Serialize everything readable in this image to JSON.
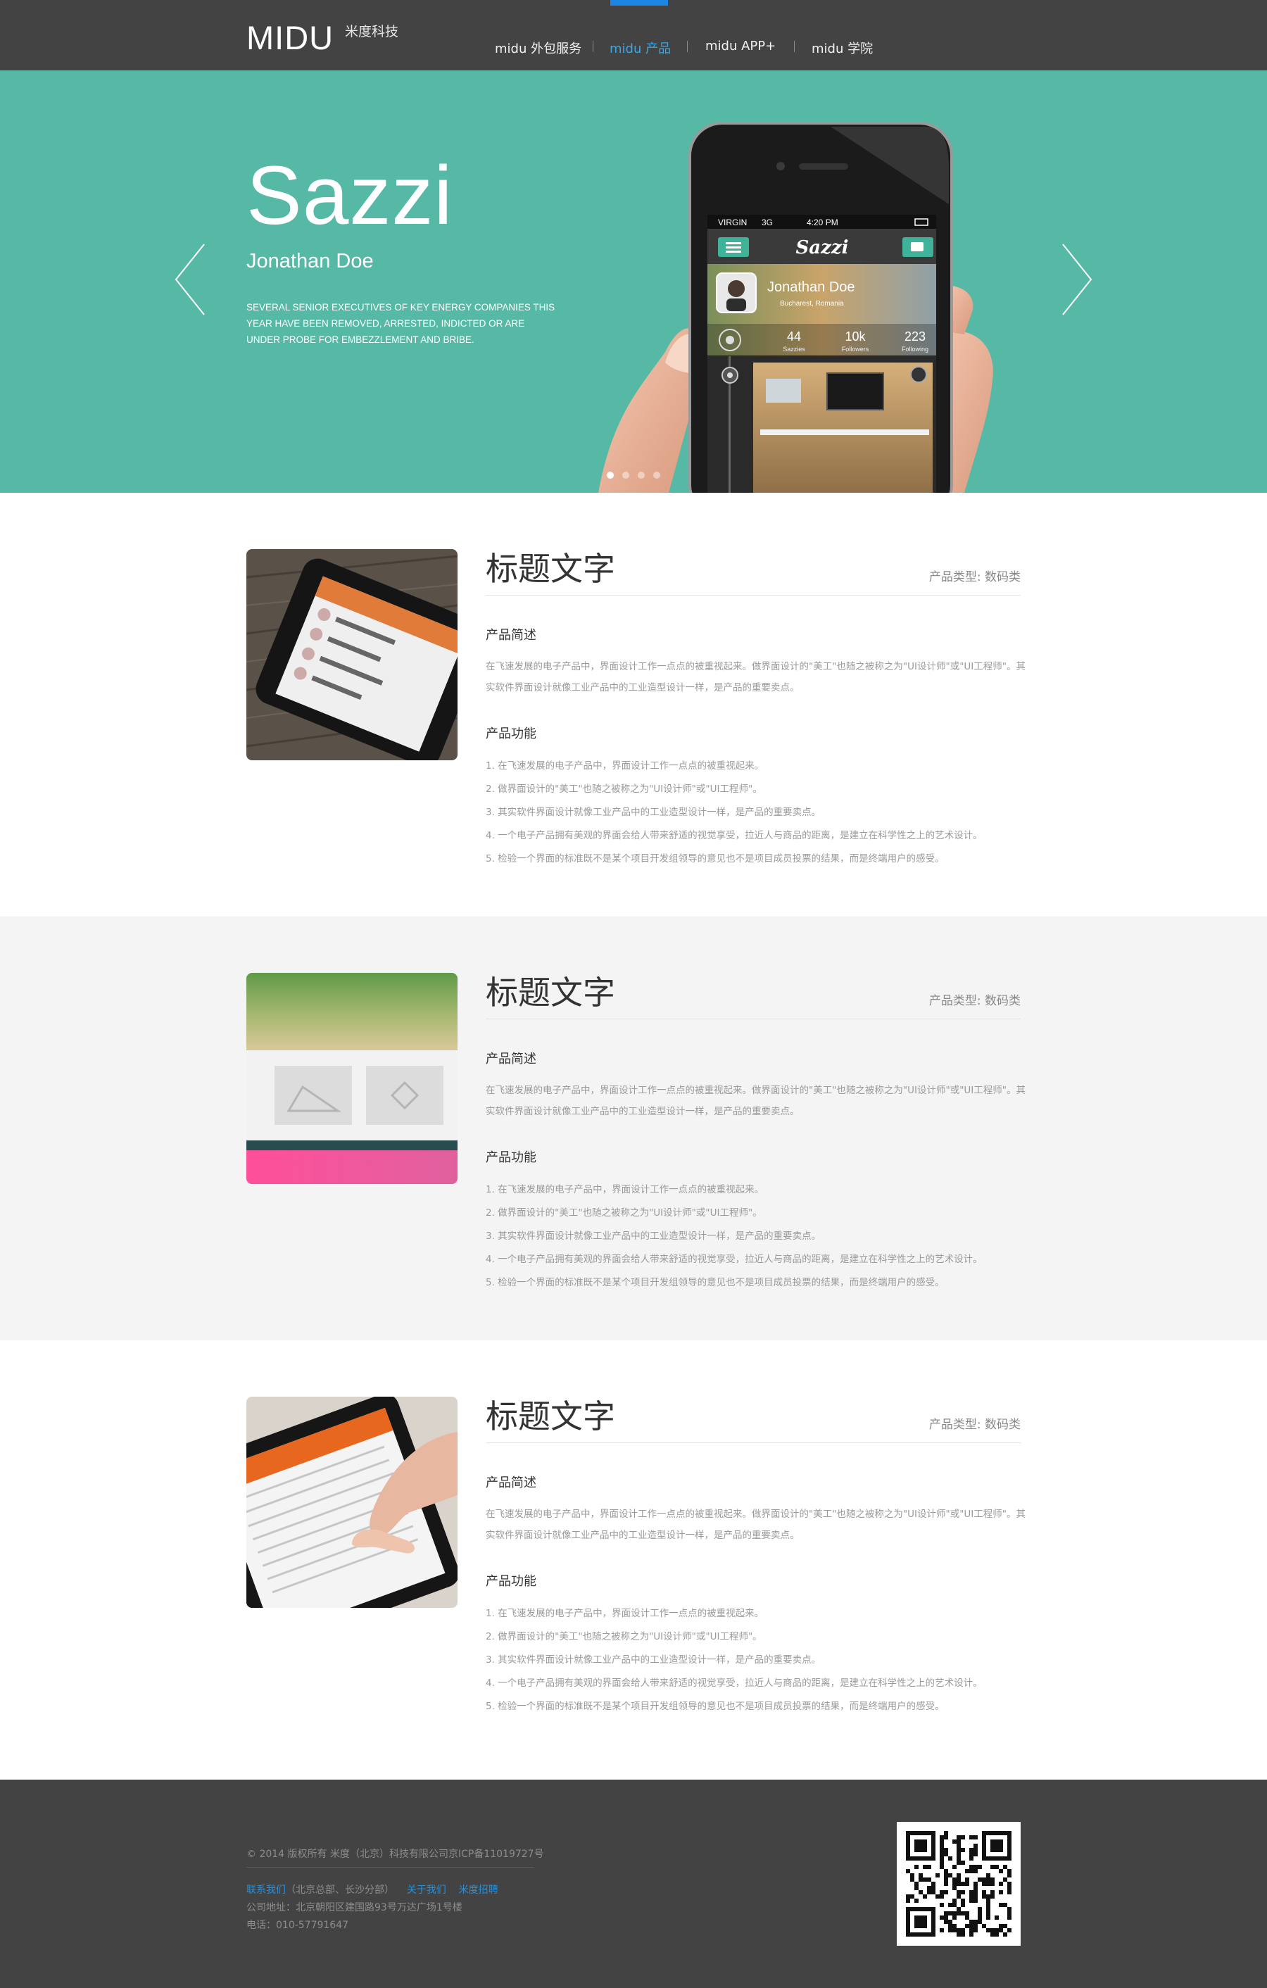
{
  "header": {
    "logo": "MIDU",
    "logo_sub": "米度科技",
    "nav": [
      {
        "label": "midu 外包服务",
        "active": false
      },
      {
        "label": "midu 产品",
        "active": true
      },
      {
        "label": "midu APP+",
        "active": false
      },
      {
        "label": "midu 学院",
        "active": false
      }
    ]
  },
  "hero": {
    "title": "Sazzi",
    "subtitle": "Jonathan Doe",
    "description": "SEVERAL SENIOR EXECUTIVES OF KEY ENERGY COMPANIES THIS YEAR HAVE BEEN REMOVED, ARRESTED, INDICTED OR ARE UNDER PROBE FOR EMBEZZLEMENT AND BRIBE.",
    "slide_count": 4,
    "active_slide": 1,
    "accent": "#56b9a5",
    "phone": {
      "carrier": "VIRGIN",
      "network": "3G",
      "time": "4:20 PM",
      "app_name": "Sazzi",
      "profile_name": "Jonathan Doe",
      "location": "Bucharest, Romania",
      "stats": [
        {
          "value": "44",
          "label": "Sazzies"
        },
        {
          "value": "10k",
          "label": "Followers"
        },
        {
          "value": "223",
          "label": "Following"
        }
      ]
    }
  },
  "products": [
    {
      "title": "标题文字",
      "type_label": "产品类型:",
      "type_value": "数码类",
      "desc_heading": "产品简述",
      "desc_line1": "在飞速发展的电子产品中，界面设计工作一点点的被重视起来。做界面设计的\"美工\"也随之被称之为\"UI设计师\"或\"UI工程师\"。其",
      "desc_line2": "实软件界面设计就像工业产品中的工业造型设计一样，是产品的重要卖点。",
      "feature_heading": "产品功能",
      "features": [
        "1. 在飞速发展的电子产品中，界面设计工作一点点的被重视起来。",
        "2. 做界面设计的\"美工\"也随之被称之为\"UI设计师\"或\"UI工程师\"。",
        "3. 其实软件界面设计就像工业产品中的工业造型设计一样，是产品的重要卖点。",
        "4. 一个电子产品拥有美观的界面会给人带来舒适的视觉享受，拉近人与商品的距离，是建立在科学性之上的艺术设计。",
        "5. 检验一个界面的标准既不是某个项目开发组领导的意见也不是项目成员投票的结果，而是终端用户的感受。"
      ]
    },
    {
      "title": "标题文字",
      "type_label": "产品类型:",
      "type_value": "数码类",
      "desc_heading": "产品简述",
      "desc_line1": "在飞速发展的电子产品中，界面设计工作一点点的被重视起来。做界面设计的\"美工\"也随之被称之为\"UI设计师\"或\"UI工程师\"。其",
      "desc_line2": "实软件界面设计就像工业产品中的工业造型设计一样，是产品的重要卖点。",
      "feature_heading": "产品功能",
      "features": [
        "1. 在飞速发展的电子产品中，界面设计工作一点点的被重视起来。",
        "2. 做界面设计的\"美工\"也随之被称之为\"UI设计师\"或\"UI工程师\"。",
        "3. 其实软件界面设计就像工业产品中的工业造型设计一样，是产品的重要卖点。",
        "4. 一个电子产品拥有美观的界面会给人带来舒适的视觉享受，拉近人与商品的距离，是建立在科学性之上的艺术设计。",
        "5. 检验一个界面的标准既不是某个项目开发组领导的意见也不是项目成员投票的结果，而是终端用户的感受。"
      ]
    },
    {
      "title": "标题文字",
      "type_label": "产品类型:",
      "type_value": "数码类",
      "desc_heading": "产品简述",
      "desc_line1": "在飞速发展的电子产品中，界面设计工作一点点的被重视起来。做界面设计的\"美工\"也随之被称之为\"UI设计师\"或\"UI工程师\"。其",
      "desc_line2": "实软件界面设计就像工业产品中的工业造型设计一样，是产品的重要卖点。",
      "feature_heading": "产品功能",
      "features": [
        "1. 在飞速发展的电子产品中，界面设计工作一点点的被重视起来。",
        "2. 做界面设计的\"美工\"也随之被称之为\"UI设计师\"或\"UI工程师\"。",
        "3. 其实软件界面设计就像工业产品中的工业造型设计一样，是产品的重要卖点。",
        "4. 一个电子产品拥有美观的界面会给人带来舒适的视觉享受，拉近人与商品的距离，是建立在科学性之上的艺术设计。",
        "5. 检验一个界面的标准既不是某个项目开发组领导的意见也不是项目成员投票的结果，而是终端用户的感受。"
      ]
    }
  ],
  "footer": {
    "copyright": "© 2014 版权所有 米度（北京）科技有限公司京ICP备11019727号",
    "contact_link": "联系我们",
    "contact_note": "（北京总部、长沙分部）",
    "about_link": "关于我们",
    "jobs_link": "米度招聘",
    "address": "公司地址：北京朝阳区建国路93号万达广场1号楼",
    "phone": "电话：010-57791647"
  },
  "colors": {
    "header_bg": "#434344",
    "nav_active": "#3ea5e0",
    "hero_bg": "#56b9a5",
    "link": "#2b8fd6"
  }
}
